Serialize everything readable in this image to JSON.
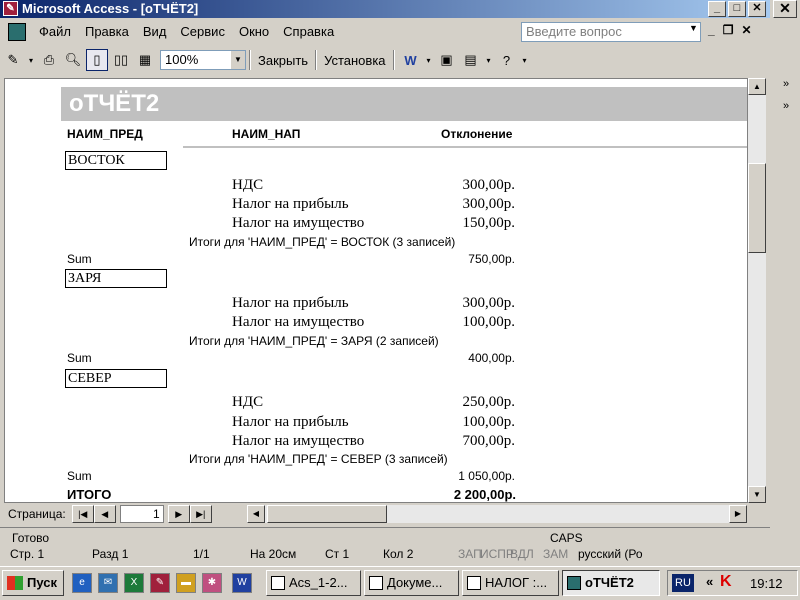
{
  "window": {
    "title": "Microsoft Access - [оТЧЁТ2]"
  },
  "menu": [
    "Файл",
    "Правка",
    "Вид",
    "Сервис",
    "Окно",
    "Справка"
  ],
  "question_placeholder": "Введите вопрос",
  "toolbar": {
    "zoom": "100%",
    "close": "Закрыть",
    "setup": "Установка"
  },
  "report": {
    "title": "оТЧЁТ2",
    "headers": {
      "pred": "НАИМ_ПРЕД",
      "nap": "НАИМ_НАП",
      "dev": "Отклонение"
    },
    "groups": [
      {
        "name": "ВОСТОК",
        "rows": [
          {
            "name": "НДС",
            "value": "300,00р."
          },
          {
            "name": "Налог на прибыль",
            "value": "300,00р."
          },
          {
            "name": "Налог на имущество",
            "value": "150,00р."
          }
        ],
        "summary": "Итоги для 'НАИМ_ПРЕД' =  ВОСТОК (3 записей)",
        "sum_label": "Sum",
        "sum": "750,00р."
      },
      {
        "name": "ЗАРЯ",
        "rows": [
          {
            "name": "Налог на прибыль",
            "value": "300,00р."
          },
          {
            "name": "Налог на имущество",
            "value": "100,00р."
          }
        ],
        "summary": "Итоги для 'НАИМ_ПРЕД' =  ЗАРЯ (2 записей)",
        "sum_label": "Sum",
        "sum": "400,00р."
      },
      {
        "name": "СЕВЕР",
        "rows": [
          {
            "name": "НДС",
            "value": "250,00р."
          },
          {
            "name": "Налог на прибыль",
            "value": "100,00р."
          },
          {
            "name": "Налог на имущество",
            "value": "700,00р."
          }
        ],
        "summary": "Итоги для 'НАИМ_ПРЕД' =  СЕВЕР (3 записей)",
        "sum_label": "Sum",
        "sum": "1 050,00р."
      }
    ],
    "total_label": "ИТОГО",
    "total": "2 200,00р."
  },
  "nav": {
    "label": "Страница:",
    "page": "1"
  },
  "status": {
    "text": "Готово",
    "caps": "CAPS"
  },
  "behind_status": [
    "Стр. 1",
    "Разд 1",
    "1/1",
    "На 20см",
    "Ст 1",
    "Кол 2",
    "ЗАП",
    "ИСПР",
    "ВДЛ",
    "ЗАМ",
    "русский (Ро"
  ],
  "taskbar": {
    "start": "Пуск",
    "tasks": [
      "Acs_1-2...",
      "Докуме...",
      "НАЛОГ :...",
      "оТЧЁТ2"
    ],
    "lang": "RU",
    "time": "19:12"
  }
}
